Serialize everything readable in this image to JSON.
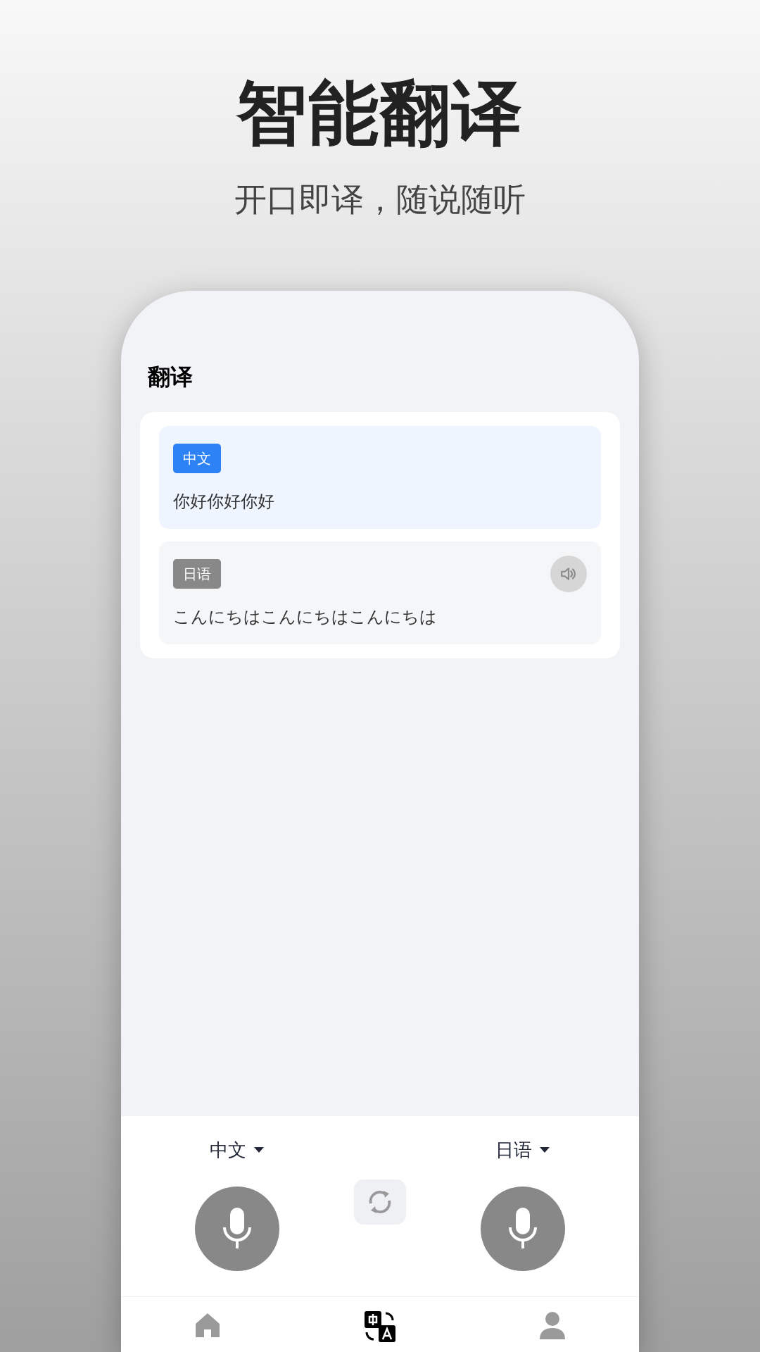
{
  "headline": "智能翻译",
  "tagline": "开口即译，随说随听",
  "screen": {
    "title": "翻译",
    "results": [
      {
        "kind": "source",
        "language": "中文",
        "text": "你好你好你好"
      },
      {
        "kind": "target",
        "language": "日语",
        "text": "こんにちはこんにちはこんにちは"
      }
    ],
    "source_language": "中文",
    "target_language": "日语",
    "tabs": [
      {
        "kind": "home",
        "selected": false
      },
      {
        "kind": "translate",
        "selected": true
      },
      {
        "kind": "profile",
        "selected": false
      }
    ]
  }
}
